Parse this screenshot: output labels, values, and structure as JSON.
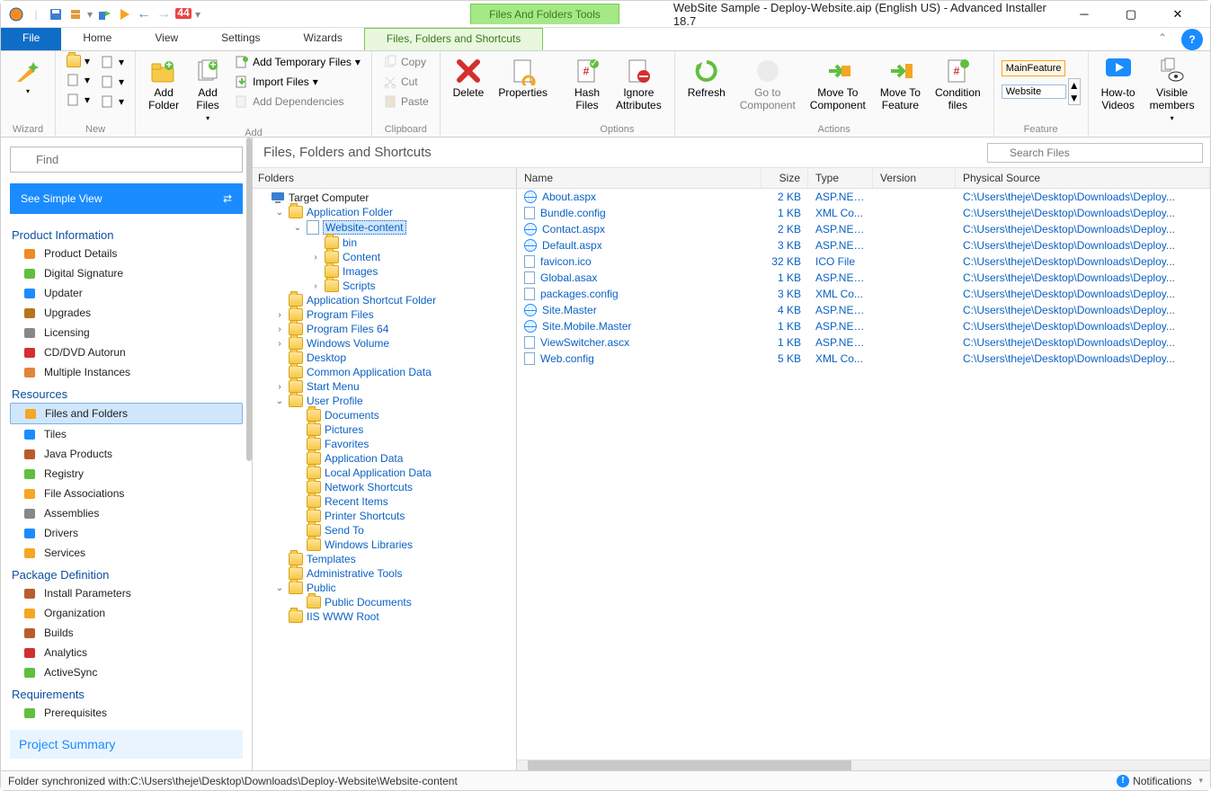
{
  "titlebar": {
    "contextual_label": "Files And Folders Tools",
    "title": "WebSite Sample - Deploy-Website.aip (English US) - Advanced Installer 18.7"
  },
  "tabs": {
    "file": "File",
    "items": [
      "Home",
      "View",
      "Settings",
      "Wizards"
    ],
    "contextual": "Files, Folders and Shortcuts"
  },
  "ribbon": {
    "wizard": {
      "label": "Wizard"
    },
    "new": {
      "label": "New"
    },
    "add": {
      "label": "Add",
      "add_folder": "Add\nFolder",
      "add_files": "Add\nFiles",
      "add_temporary": "Add Temporary Files",
      "import_files": "Import Files",
      "add_dependencies": "Add Dependencies"
    },
    "clipboard": {
      "label": "Clipboard",
      "copy": "Copy",
      "cut": "Cut",
      "paste": "Paste"
    },
    "delete": "Delete",
    "properties": "Properties",
    "options": {
      "label": "Options",
      "hash": "Hash\nFiles",
      "ignore": "Ignore\nAttributes"
    },
    "actions": {
      "label": "Actions",
      "refresh": "Refresh",
      "goto": "Go to\nComponent",
      "move_comp": "Move To\nComponent",
      "move_feat": "Move To\nFeature",
      "cond": "Condition\nfiles"
    },
    "feature": {
      "label": "Feature",
      "main": "MainFeature",
      "combo": "Website"
    },
    "howto": "How-to\nVideos",
    "visible": "Visible\nmembers"
  },
  "leftnav": {
    "find_placeholder": "Find",
    "simple_view": "See Simple View",
    "sections": [
      {
        "title": "Product Information",
        "items": [
          "Product Details",
          "Digital Signature",
          "Updater",
          "Upgrades",
          "Licensing",
          "CD/DVD Autorun",
          "Multiple Instances"
        ]
      },
      {
        "title": "Resources",
        "items": [
          "Files and Folders",
          "Tiles",
          "Java Products",
          "Registry",
          "File Associations",
          "Assemblies",
          "Drivers",
          "Services"
        ]
      },
      {
        "title": "Package Definition",
        "items": [
          "Install Parameters",
          "Organization",
          "Builds",
          "Analytics",
          "ActiveSync"
        ]
      },
      {
        "title": "Requirements",
        "items": [
          "Prerequisites"
        ]
      }
    ],
    "active": "Files and Folders",
    "project_summary": "Project Summary"
  },
  "center": {
    "title": "Files, Folders and Shortcuts",
    "search_placeholder": "Search Files",
    "folders_header": "Folders",
    "tree": [
      {
        "d": 0,
        "label": "Target Computer",
        "icon": "computer",
        "expand": "",
        "root": true
      },
      {
        "d": 1,
        "label": "Application Folder",
        "icon": "folder",
        "expand": "open"
      },
      {
        "d": 2,
        "label": "Website-content",
        "icon": "page",
        "expand": "open",
        "selected": true
      },
      {
        "d": 3,
        "label": "bin",
        "icon": "folder",
        "expand": ""
      },
      {
        "d": 3,
        "label": "Content",
        "icon": "folder",
        "expand": "closed"
      },
      {
        "d": 3,
        "label": "Images",
        "icon": "folder",
        "expand": ""
      },
      {
        "d": 3,
        "label": "Scripts",
        "icon": "folder",
        "expand": "closed"
      },
      {
        "d": 1,
        "label": "Application Shortcut Folder",
        "icon": "folder",
        "expand": ""
      },
      {
        "d": 1,
        "label": "Program Files",
        "icon": "folder",
        "expand": "closed"
      },
      {
        "d": 1,
        "label": "Program Files 64",
        "icon": "folder",
        "expand": "closed"
      },
      {
        "d": 1,
        "label": "Windows Volume",
        "icon": "folder",
        "expand": "closed"
      },
      {
        "d": 1,
        "label": "Desktop",
        "icon": "folder",
        "expand": ""
      },
      {
        "d": 1,
        "label": "Common Application Data",
        "icon": "folder",
        "expand": ""
      },
      {
        "d": 1,
        "label": "Start Menu",
        "icon": "folder",
        "expand": "closed"
      },
      {
        "d": 1,
        "label": "User Profile",
        "icon": "folder",
        "expand": "open"
      },
      {
        "d": 2,
        "label": "Documents",
        "icon": "folder",
        "expand": ""
      },
      {
        "d": 2,
        "label": "Pictures",
        "icon": "folder",
        "expand": ""
      },
      {
        "d": 2,
        "label": "Favorites",
        "icon": "folder",
        "expand": ""
      },
      {
        "d": 2,
        "label": "Application Data",
        "icon": "folder",
        "expand": ""
      },
      {
        "d": 2,
        "label": "Local Application Data",
        "icon": "folder",
        "expand": ""
      },
      {
        "d": 2,
        "label": "Network Shortcuts",
        "icon": "folder",
        "expand": ""
      },
      {
        "d": 2,
        "label": "Recent Items",
        "icon": "folder",
        "expand": ""
      },
      {
        "d": 2,
        "label": "Printer Shortcuts",
        "icon": "folder",
        "expand": ""
      },
      {
        "d": 2,
        "label": "Send To",
        "icon": "folder",
        "expand": ""
      },
      {
        "d": 2,
        "label": "Windows Libraries",
        "icon": "folder",
        "expand": ""
      },
      {
        "d": 1,
        "label": "Templates",
        "icon": "folder",
        "expand": ""
      },
      {
        "d": 1,
        "label": "Administrative Tools",
        "icon": "folder",
        "expand": ""
      },
      {
        "d": 1,
        "label": "Public",
        "icon": "folder",
        "expand": "open"
      },
      {
        "d": 2,
        "label": "Public Documents",
        "icon": "folder",
        "expand": ""
      },
      {
        "d": 1,
        "label": "IIS WWW Root",
        "icon": "folder",
        "expand": ""
      }
    ],
    "columns": {
      "name": "Name",
      "size": "Size",
      "type": "Type",
      "version": "Version",
      "path": "Physical Source"
    },
    "files": [
      {
        "name": "About.aspx",
        "size": "2 KB",
        "type": "ASP.NET...",
        "icon": "globe",
        "path": "C:\\Users\\theje\\Desktop\\Downloads\\Deploy..."
      },
      {
        "name": "Bundle.config",
        "size": "1 KB",
        "type": "XML Co...",
        "icon": "page",
        "path": "C:\\Users\\theje\\Desktop\\Downloads\\Deploy..."
      },
      {
        "name": "Contact.aspx",
        "size": "2 KB",
        "type": "ASP.NET...",
        "icon": "globe",
        "path": "C:\\Users\\theje\\Desktop\\Downloads\\Deploy..."
      },
      {
        "name": "Default.aspx",
        "size": "3 KB",
        "type": "ASP.NET...",
        "icon": "globe",
        "path": "C:\\Users\\theje\\Desktop\\Downloads\\Deploy..."
      },
      {
        "name": "favicon.ico",
        "size": "32 KB",
        "type": "ICO File",
        "icon": "page",
        "path": "C:\\Users\\theje\\Desktop\\Downloads\\Deploy..."
      },
      {
        "name": "Global.asax",
        "size": "1 KB",
        "type": "ASP.NET...",
        "icon": "page",
        "path": "C:\\Users\\theje\\Desktop\\Downloads\\Deploy..."
      },
      {
        "name": "packages.config",
        "size": "3 KB",
        "type": "XML Co...",
        "icon": "page",
        "path": "C:\\Users\\theje\\Desktop\\Downloads\\Deploy..."
      },
      {
        "name": "Site.Master",
        "size": "4 KB",
        "type": "ASP.NET...",
        "icon": "globe",
        "path": "C:\\Users\\theje\\Desktop\\Downloads\\Deploy..."
      },
      {
        "name": "Site.Mobile.Master",
        "size": "1 KB",
        "type": "ASP.NET...",
        "icon": "globe",
        "path": "C:\\Users\\theje\\Desktop\\Downloads\\Deploy..."
      },
      {
        "name": "ViewSwitcher.ascx",
        "size": "1 KB",
        "type": "ASP.NET...",
        "icon": "page",
        "path": "C:\\Users\\theje\\Desktop\\Downloads\\Deploy..."
      },
      {
        "name": "Web.config",
        "size": "5 KB",
        "type": "XML Co...",
        "icon": "page",
        "path": "C:\\Users\\theje\\Desktop\\Downloads\\Deploy..."
      }
    ]
  },
  "statusbar": {
    "text": "Folder synchronized with:C:\\Users\\theje\\Desktop\\Downloads\\Deploy-Website\\Website-content",
    "notifications": "Notifications"
  }
}
